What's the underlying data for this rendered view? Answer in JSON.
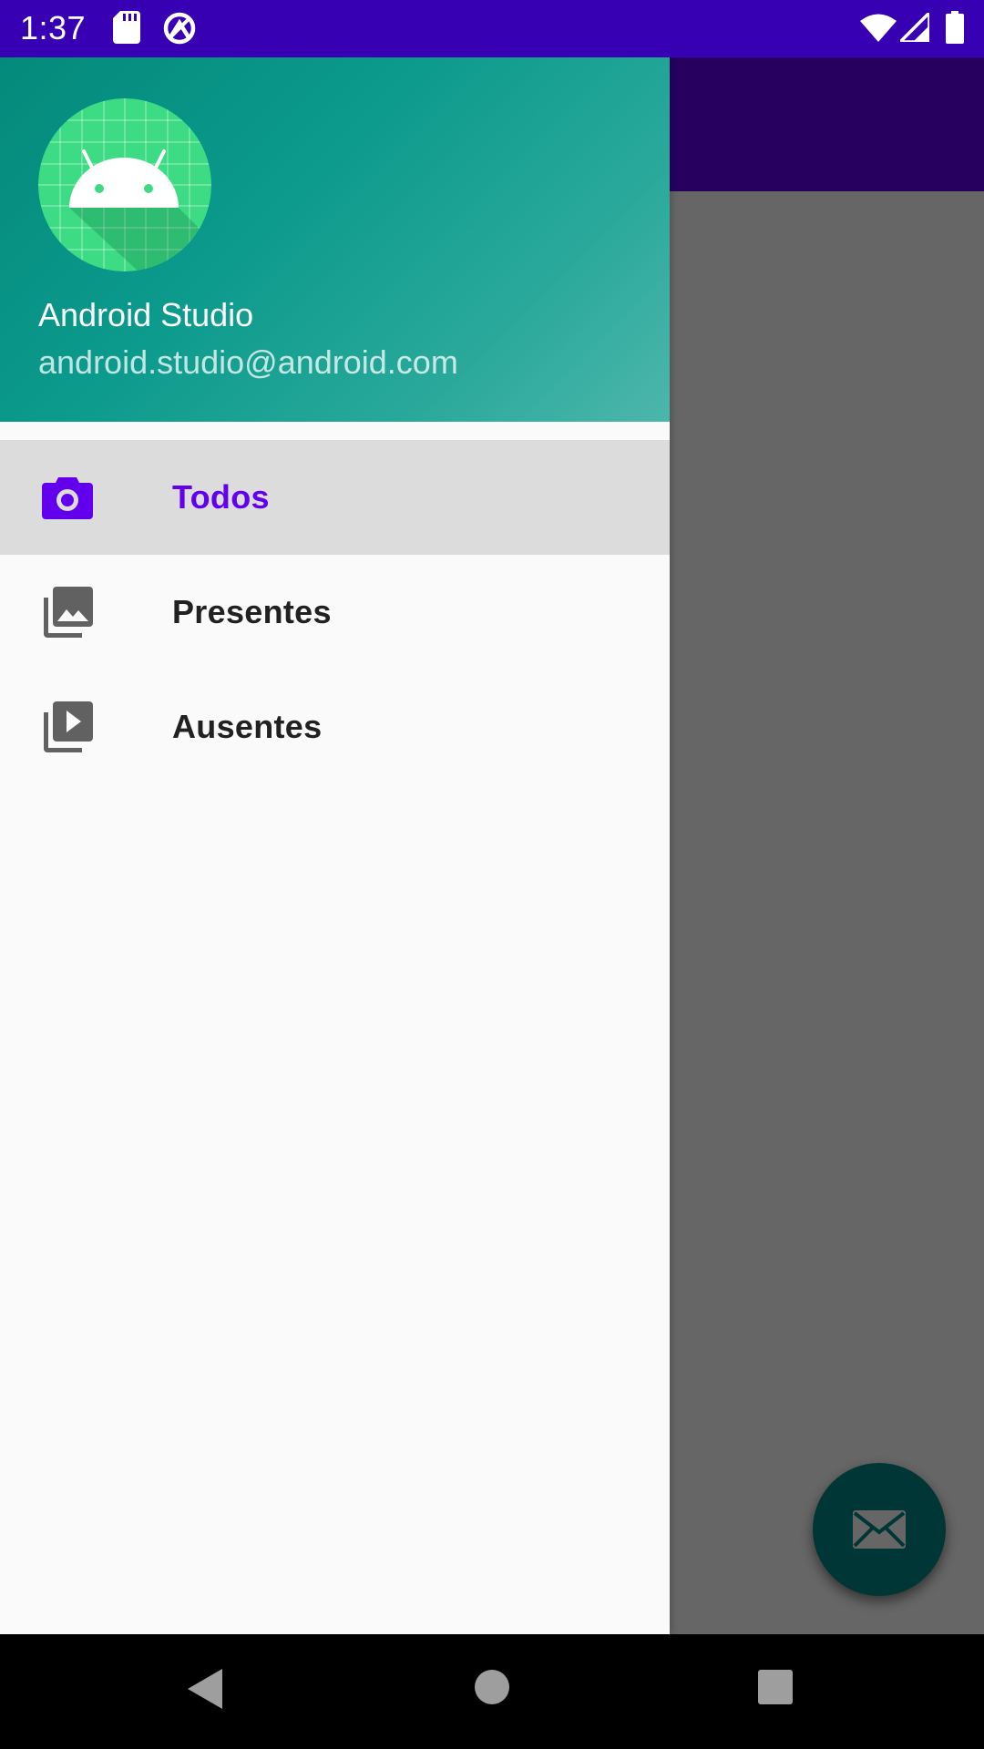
{
  "status_bar": {
    "time": "1:37",
    "icons": [
      "sd-card-icon",
      "vpn-icon",
      "wifi-icon",
      "signal-icon",
      "battery-icon"
    ]
  },
  "drawer": {
    "header": {
      "user_name": "Android Studio",
      "user_email": "android.studio@android.com",
      "avatar_icon": "android-icon"
    },
    "menu": [
      {
        "label": "Todos",
        "icon": "camera-icon",
        "selected": true
      },
      {
        "label": "Presentes",
        "icon": "photo-library-icon",
        "selected": false
      },
      {
        "label": "Ausentes",
        "icon": "video-library-icon",
        "selected": false
      }
    ]
  },
  "fab": {
    "icon": "email-icon"
  },
  "nav_bar": {
    "buttons": [
      "back-icon",
      "home-icon",
      "recents-icon"
    ]
  },
  "colors": {
    "primary": "#6200ee",
    "primary_dark": "#3700b3",
    "accent": "#018786",
    "header_gradient_start": "#048a7b",
    "header_gradient_end": "#4db6ac"
  }
}
